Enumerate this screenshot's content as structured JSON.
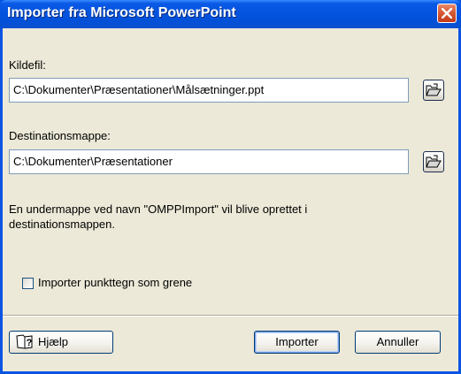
{
  "window": {
    "title": "Importer fra Microsoft PowerPoint",
    "title_color": "#0a54e3"
  },
  "source": {
    "label": "Kildefil:",
    "value": "C:\\Dokumenter\\Præsentationer\\Målsætninger.ppt",
    "browse_icon": "open-folder-icon"
  },
  "destination": {
    "label": "Destinationsmappe:",
    "value": "C:\\Dokumenter\\Præsentationer",
    "browse_icon": "open-folder-icon"
  },
  "info_text": "En undermappe ved navn \"OMPPImport\" vil blive oprettet i destinationsmappen.",
  "option": {
    "label": "Importer punkttegn som grene",
    "checked": false
  },
  "buttons": {
    "help": "Hjælp",
    "help_icon": "help-book-icon",
    "import": "Importer",
    "cancel": "Annuller"
  }
}
